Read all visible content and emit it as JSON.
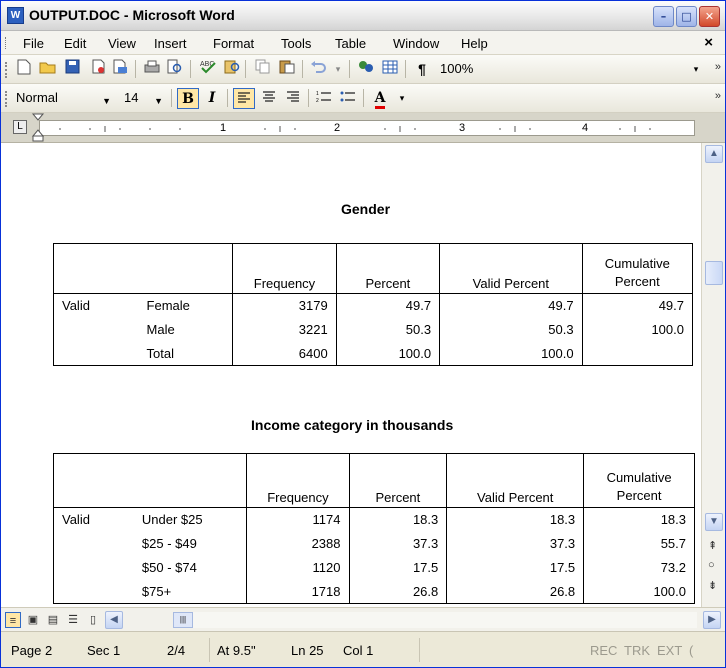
{
  "window": {
    "title": "OUTPUT.DOC - Microsoft Word",
    "app_icon": "W",
    "minimize": "–",
    "maximize": "□",
    "close": "✕"
  },
  "menu": {
    "items": [
      "File",
      "Edit",
      "View",
      "Insert",
      "Format",
      "Tools",
      "Table",
      "Window",
      "Help"
    ],
    "close_glyph": "×"
  },
  "toolbar1": {
    "icons": [
      "new-icon",
      "open-icon",
      "save-icon",
      "permission-icon",
      "email-icon",
      "print-icon",
      "print-preview-icon",
      "spelling-icon",
      "research-icon",
      "copy-icon",
      "paste-icon",
      "undo-icon",
      "undo-dropdown-icon",
      "hyperlink-icon",
      "tables-borders-icon",
      "show-hide-icon"
    ],
    "zoom": "100%",
    "pilcrow": "¶"
  },
  "toolbar2": {
    "style": "Normal",
    "font_size": "14",
    "bold": "B",
    "italic": "I",
    "font_color_label": "A"
  },
  "ruler": {
    "numbers": [
      "1",
      "2",
      "3",
      "4"
    ]
  },
  "tables": [
    {
      "title": "Gender",
      "headers": [
        "",
        "",
        "Frequency",
        "Percent",
        "Valid Percent",
        "Cumulative\nPercent"
      ],
      "rows": [
        [
          "Valid",
          "Female",
          "3179",
          "49.7",
          "49.7",
          "49.7"
        ],
        [
          "",
          "Male",
          "3221",
          "50.3",
          "50.3",
          "100.0"
        ],
        [
          "",
          "Total",
          "6400",
          "100.0",
          "100.0",
          ""
        ]
      ]
    },
    {
      "title": "Income category in thousands",
      "headers": [
        "",
        "",
        "Frequency",
        "Percent",
        "Valid Percent",
        "Cumulative\nPercent"
      ],
      "rows": [
        [
          "Valid",
          "Under $25",
          "1174",
          "18.3",
          "18.3",
          "18.3"
        ],
        [
          "",
          "$25 - $49",
          "2388",
          "37.3",
          "37.3",
          "55.7"
        ],
        [
          "",
          "$50 - $74",
          "1120",
          "17.5",
          "17.5",
          "73.2"
        ],
        [
          "",
          "$75+",
          "1718",
          "26.8",
          "26.8",
          "100.0"
        ]
      ]
    }
  ],
  "status": {
    "page": "Page 2",
    "section": "Sec 1",
    "page_of": "2/4",
    "at": "At 9.5\"",
    "line": "Ln 25",
    "col": "Col 1",
    "rec": "REC",
    "trk": "TRK",
    "ext": "EXT",
    "ovr": "("
  },
  "colors": {
    "font_color_underline": "#e00000",
    "titlebar_accent": "#0831d9"
  }
}
